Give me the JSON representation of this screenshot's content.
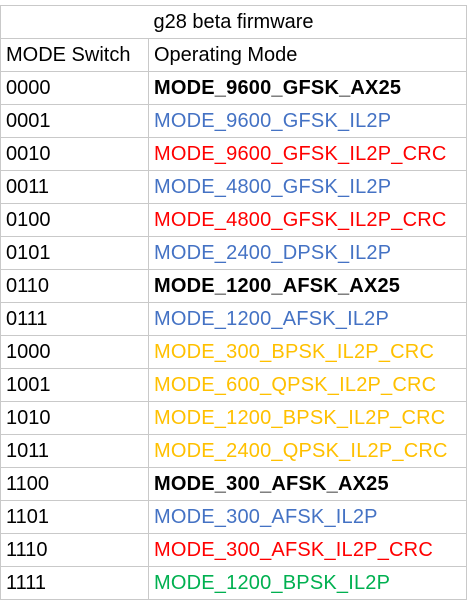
{
  "title": "g28 beta firmware",
  "headers": {
    "switch": "MODE Switch",
    "mode": "Operating Mode"
  },
  "colors": {
    "black": "#000000",
    "blue": "#4472c4",
    "red": "#ff0000",
    "orange": "#ffc000",
    "green": "#00b050"
  },
  "rows": [
    {
      "switch": "0000",
      "mode": "MODE_9600_GFSK_AX25",
      "color": "black",
      "bold": true
    },
    {
      "switch": "0001",
      "mode": "MODE_9600_GFSK_IL2P",
      "color": "blue",
      "bold": false
    },
    {
      "switch": "0010",
      "mode": "MODE_9600_GFSK_IL2P_CRC",
      "color": "red",
      "bold": false
    },
    {
      "switch": "0011",
      "mode": "MODE_4800_GFSK_IL2P",
      "color": "blue",
      "bold": false
    },
    {
      "switch": "0100",
      "mode": "MODE_4800_GFSK_IL2P_CRC",
      "color": "red",
      "bold": false
    },
    {
      "switch": "0101",
      "mode": "MODE_2400_DPSK_IL2P",
      "color": "blue",
      "bold": false
    },
    {
      "switch": "0110",
      "mode": "MODE_1200_AFSK_AX25",
      "color": "black",
      "bold": true
    },
    {
      "switch": "0111",
      "mode": "MODE_1200_AFSK_IL2P",
      "color": "blue",
      "bold": false
    },
    {
      "switch": "1000",
      "mode": "MODE_300_BPSK_IL2P_CRC",
      "color": "orange",
      "bold": false
    },
    {
      "switch": "1001",
      "mode": "MODE_600_QPSK_IL2P_CRC",
      "color": "orange",
      "bold": false
    },
    {
      "switch": "1010",
      "mode": "MODE_1200_BPSK_IL2P_CRC",
      "color": "orange",
      "bold": false
    },
    {
      "switch": "1011",
      "mode": "MODE_2400_QPSK_IL2P_CRC",
      "color": "orange",
      "bold": false
    },
    {
      "switch": "1100",
      "mode": "MODE_300_AFSK_AX25",
      "color": "black",
      "bold": true
    },
    {
      "switch": "1101",
      "mode": "MODE_300_AFSK_IL2P",
      "color": "blue",
      "bold": false
    },
    {
      "switch": "1110",
      "mode": "MODE_300_AFSK_IL2P_CRC",
      "color": "red",
      "bold": false
    },
    {
      "switch": "1111",
      "mode": "MODE_1200_BPSK_IL2P",
      "color": "green",
      "bold": false
    }
  ]
}
